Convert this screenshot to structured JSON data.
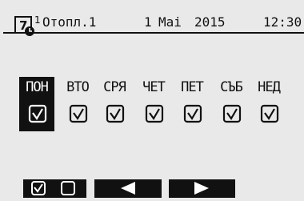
{
  "header": {
    "screen_number": "1",
    "mode_label": "Отопл.1",
    "date_day": "1",
    "date_month": "Mai",
    "date_year": "2015",
    "time": "12:30",
    "icon": "calendar-clock-icon"
  },
  "days": [
    {
      "label": "ПОН",
      "checked": true,
      "selected": true
    },
    {
      "label": "ВТО",
      "checked": true,
      "selected": false
    },
    {
      "label": "СРЯ",
      "checked": true,
      "selected": false
    },
    {
      "label": "ЧЕТ",
      "checked": true,
      "selected": false
    },
    {
      "label": "ПЕТ",
      "checked": true,
      "selected": false
    },
    {
      "label": "СЪБ",
      "checked": true,
      "selected": false
    },
    {
      "label": "НЕД",
      "checked": true,
      "selected": false
    }
  ],
  "softkeys": [
    {
      "name": "toggle-check-key",
      "icons": [
        "checked-box-icon",
        "empty-box-icon"
      ]
    },
    {
      "name": "left-arrow-key",
      "icons": [
        "left-arrow-icon"
      ]
    },
    {
      "name": "right-arrow-key",
      "icons": [
        "right-arrow-icon"
      ]
    }
  ],
  "colors": {
    "background": "#e9e9e9",
    "foreground": "#111111",
    "selected_bg": "#111111",
    "selected_fg": "#ffffff"
  }
}
